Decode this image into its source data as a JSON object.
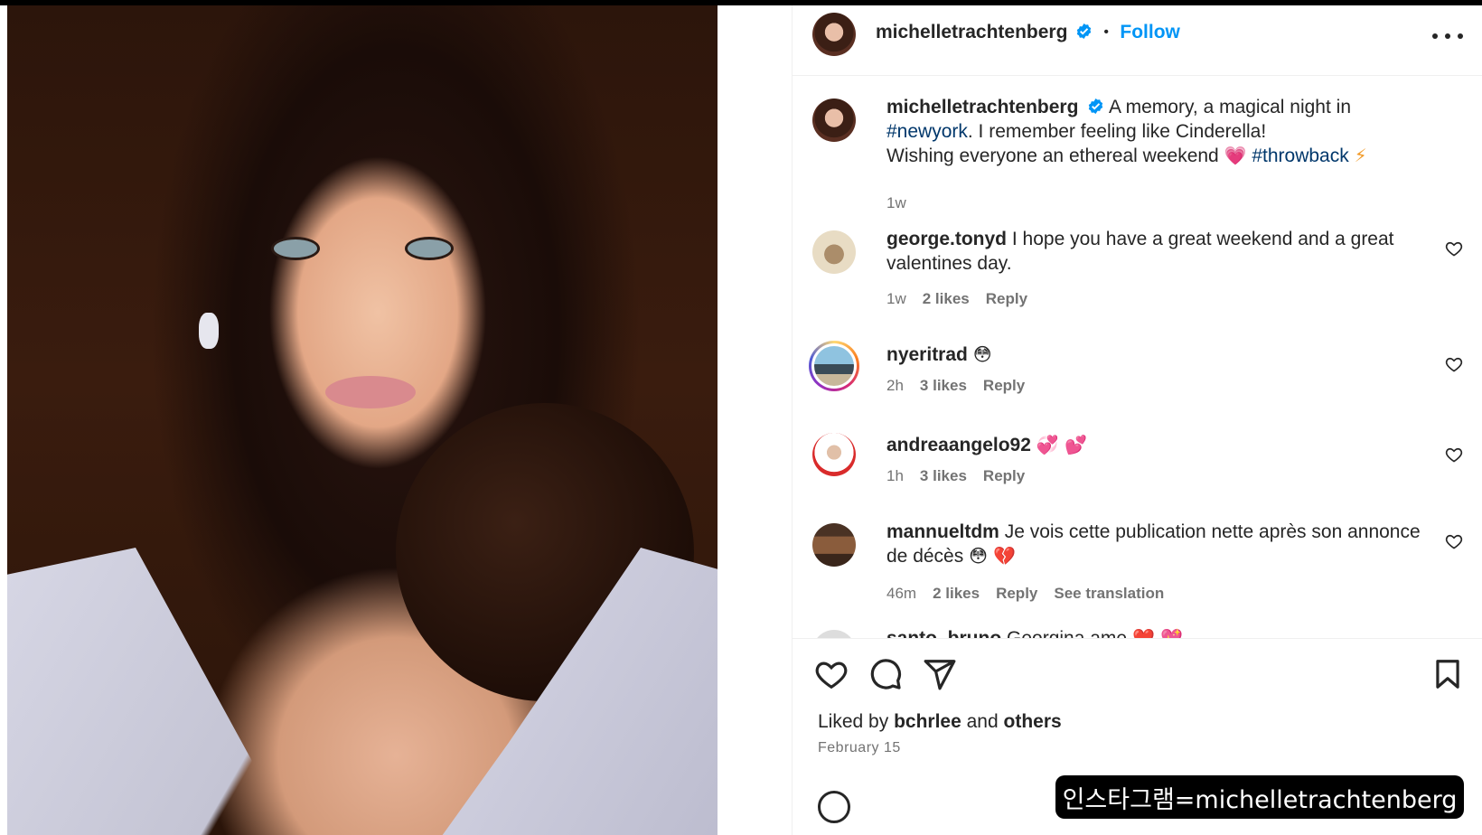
{
  "post": {
    "username": "michelletrachtenberg",
    "follow_label": "Follow",
    "separator": "•",
    "caption_part1": "A memory, a magical night in",
    "caption_hashtag1": "#newyork",
    "caption_part2": ". I remember feeling like Cinderella!",
    "caption_part3": "Wishing everyone an ethereal weekend",
    "caption_heart": "💗",
    "caption_hashtag2": "#throwback",
    "caption_bolt": "⚡",
    "caption_time": "1w"
  },
  "comments": [
    {
      "username": "george.tonyd",
      "text_line1": "I hope you have a great weekend and a great",
      "text_line2": "valentines day.",
      "time": "1w",
      "likes": "2 likes",
      "reply": "Reply"
    },
    {
      "username": "nyeritrad",
      "emoji": "😳",
      "time": "2h",
      "likes": "3 likes",
      "reply": "Reply"
    },
    {
      "username": "andreaangelo92",
      "emoji": "💞 💕",
      "time": "1h",
      "likes": "3 likes",
      "reply": "Reply"
    },
    {
      "username": "mannueltdm",
      "text_line1": "Je vois cette publication nette après son annonce",
      "text_line2": "de décès",
      "emoji": "😳 💔",
      "time": "46m",
      "likes": "2 likes",
      "reply": "Reply",
      "translate": "See translation"
    },
    {
      "username": "santo_bruno",
      "text_line1": "Georgina ame",
      "emoji": "❤️ 💖"
    }
  ],
  "footer": {
    "liked_prefix": "Liked by",
    "liked_user": "bchrlee",
    "liked_and": "and",
    "liked_others": "others",
    "date": "February 15"
  },
  "watermark": "인스타그램=michelletrachtenberg",
  "colors": {
    "accent": "#0095f6",
    "hashtag": "#00376b",
    "text": "#262626",
    "muted": "#737373"
  },
  "icons": [
    "verified-icon",
    "more-icon",
    "heart-icon",
    "comment-icon",
    "share-icon",
    "bookmark-icon"
  ]
}
